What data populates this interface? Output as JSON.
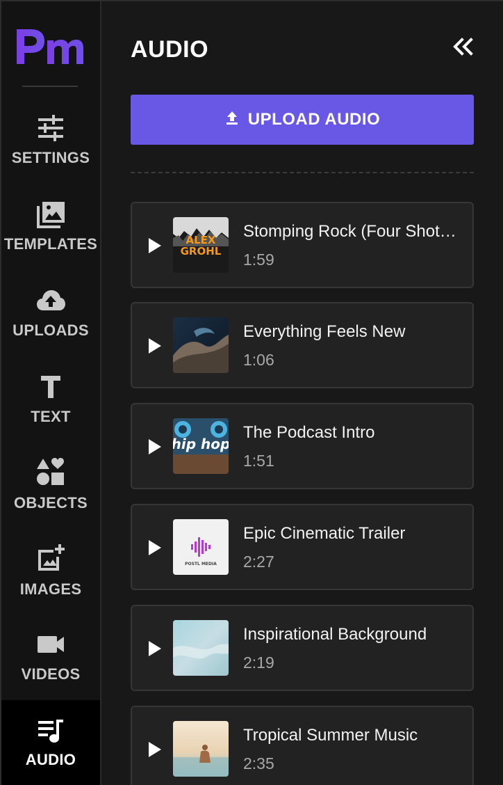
{
  "app": {
    "logo_text": "Pm",
    "colors": {
      "accent": "#6957e6",
      "logo_start": "#7b3fe4",
      "logo_end": "#6f4fe8"
    }
  },
  "nav": {
    "items": [
      {
        "label": "SETTINGS",
        "icon": "sliders-icon"
      },
      {
        "label": "TEMPLATES",
        "icon": "templates-icon"
      },
      {
        "label": "UPLOADS",
        "icon": "cloud-upload-icon"
      },
      {
        "label": "TEXT",
        "icon": "text-icon"
      },
      {
        "label": "OBJECTS",
        "icon": "shapes-icon"
      },
      {
        "label": "IMAGES",
        "icon": "add-image-icon"
      },
      {
        "label": "VIDEOS",
        "icon": "video-camera-icon"
      },
      {
        "label": "AUDIO",
        "icon": "audio-playlist-icon",
        "active": true
      }
    ]
  },
  "panel": {
    "title": "AUDIO",
    "upload_label": "UPLOAD AUDIO",
    "collapse_icon": "double-chevron-left-icon",
    "tracks": [
      {
        "title": "Stomping Rock (Four Shot…",
        "duration": "1:59",
        "thumb_text": "ALEX\nGROHL"
      },
      {
        "title": "Everything Feels New",
        "duration": "1:06"
      },
      {
        "title": "The Podcast Intro",
        "duration": "1:51",
        "thumb_text": "hip hop"
      },
      {
        "title": "Epic Cinematic Trailer",
        "duration": "2:27",
        "thumb_text": "POSTL MEDIA"
      },
      {
        "title": "Inspirational Background",
        "duration": "2:19"
      },
      {
        "title": "Tropical Summer Music",
        "duration": "2:35"
      }
    ]
  }
}
